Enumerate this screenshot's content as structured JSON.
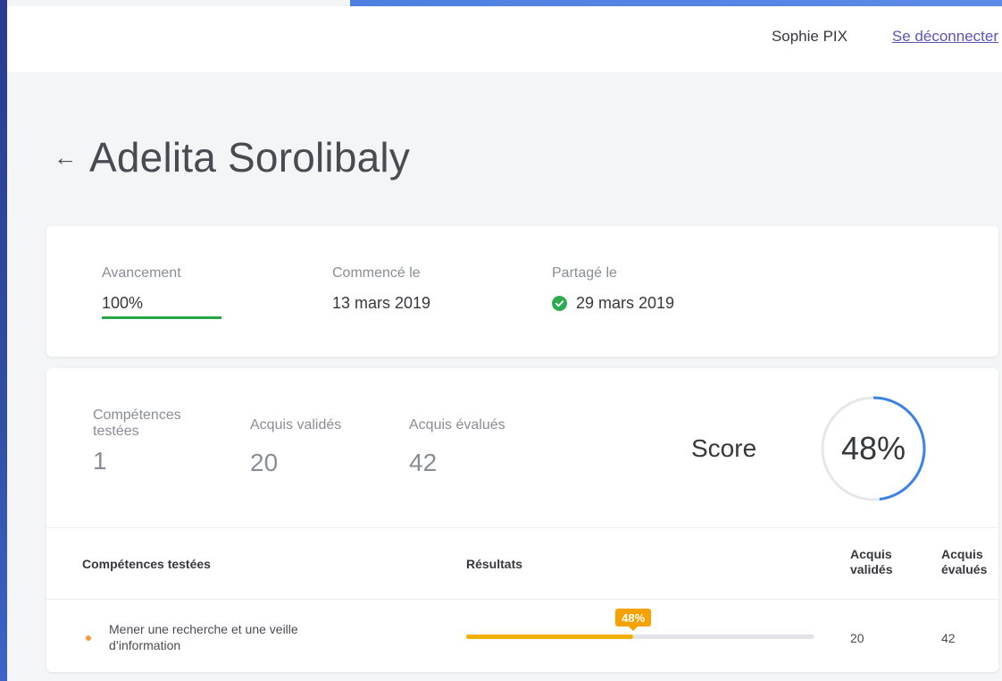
{
  "header": {
    "user_name": "Sophie PIX",
    "logout_label": "Se déconnecter"
  },
  "page": {
    "back_icon": "arrow-left-icon",
    "title": "Adelita Sorolibaly"
  },
  "summary": {
    "progress_label": "Avancement",
    "progress_value": "100%",
    "progress_fraction": 1.0,
    "started_label": "Commencé le",
    "started_value": "13 mars 2019",
    "shared_label": "Partagé le",
    "shared_value": "29 mars 2019",
    "shared_icon": "check-circle-icon"
  },
  "stats": {
    "competences_label": "Compétences testées",
    "competences_value": "1",
    "validated_label": "Acquis validés",
    "validated_value": "20",
    "evaluated_label": "Acquis évalués",
    "evaluated_value": "42",
    "score_label": "Score",
    "score_value": "48%",
    "score_fraction": 0.48
  },
  "table": {
    "headers": {
      "competences": "Compétences testées",
      "results": "Résultats",
      "validated": "Acquis validés",
      "evaluated": "Acquis évalués"
    },
    "rows": [
      {
        "name": "Mener une recherche et une veille d’information",
        "result_label": "48%",
        "result_fraction": 0.48,
        "validated": "20",
        "evaluated": "42"
      }
    ]
  },
  "colors": {
    "accent": "#5b8ae8",
    "progress_green": "#28a645",
    "score_blue": "#3d82e6",
    "bar_orange": "#f5a200",
    "link": "#5b55b8"
  }
}
